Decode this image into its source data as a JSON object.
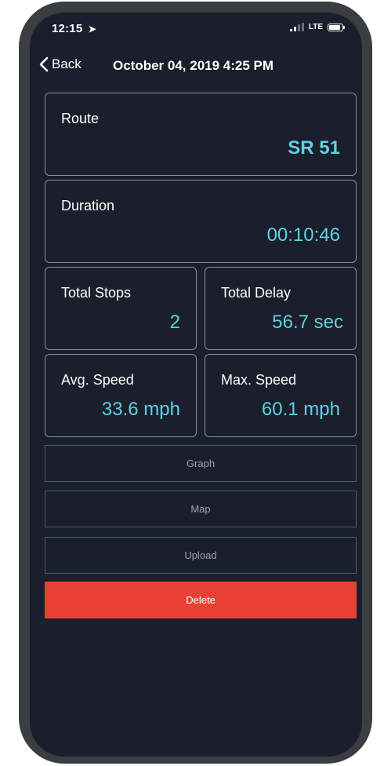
{
  "status_bar": {
    "time": "12:15",
    "location_icon": "location-arrow-icon",
    "network": "LTE",
    "signal_icon": "signal-bars-icon",
    "battery_icon": "battery-icon"
  },
  "nav": {
    "back_label": "Back",
    "back_icon": "chevron-left-icon",
    "title": "October 04, 2019 4:25 PM"
  },
  "route": {
    "label": "Route",
    "value": "SR 51"
  },
  "duration": {
    "label": "Duration",
    "value": "00:10:46"
  },
  "total_stops": {
    "label": "Total Stops",
    "value": "2"
  },
  "total_delay": {
    "label": "Total Delay",
    "value": "56.7 sec"
  },
  "avg_speed": {
    "label": "Avg. Speed",
    "value": "33.6 mph"
  },
  "max_speed": {
    "label": "Max. Speed",
    "value": "60.1 mph"
  },
  "actions": {
    "graph_label": "Graph",
    "map_label": "Map",
    "upload_label": "Upload",
    "delete_label": "Delete"
  },
  "colors": {
    "background": "#1b1f2c",
    "accent_value": "#5ed1e4",
    "delete": "#e84134",
    "card_border": "#8b8e96",
    "button_border": "#3e5f70"
  }
}
